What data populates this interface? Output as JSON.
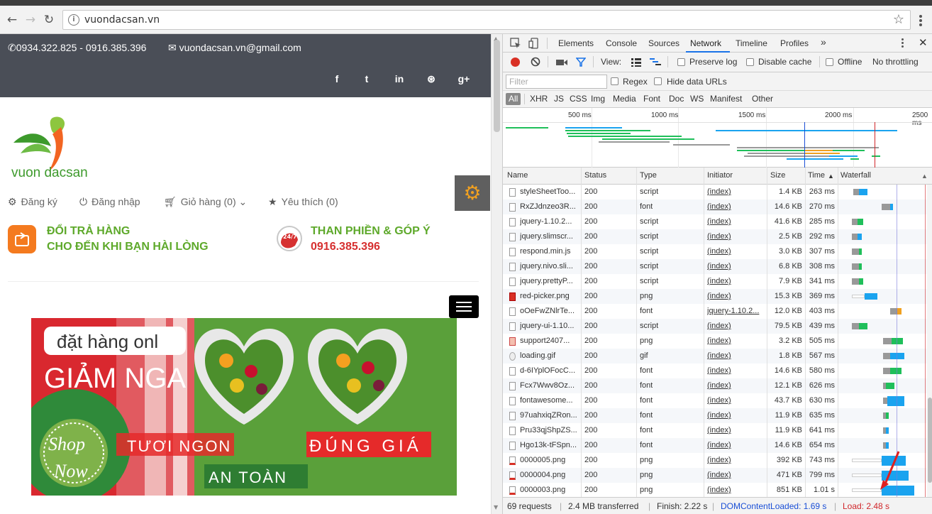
{
  "browser": {
    "url": "vuondacsan.vn"
  },
  "site": {
    "phone": "0934.322.825 - 0916.385.396",
    "email": "vuondacsan.vn@gmail.com",
    "social": [
      "f",
      "t",
      "in",
      "⊛",
      "g+"
    ],
    "logo_text": "vuon dacsan",
    "nav": [
      "Đăng ký",
      "Đăng nhập",
      "Giỏ hàng (0)",
      "Yêu thích (0)"
    ],
    "promo1": {
      "line1": "ĐỔI TRẢ HÀNG",
      "line2": "CHO ĐẾN KHI BẠN HÀI LÒNG"
    },
    "promo2": {
      "line1": "THAN PHIỀN & GÓP Ý",
      "line2": "0916.385.396",
      "badge": "24/7"
    },
    "banner": {
      "search_text": "đặt hàng onl",
      "headline": "GIẢM NGA",
      "shop_now_1": "Shop",
      "shop_now_2": "Now",
      "tag_fresh": "TƯƠI NGON",
      "tag_price": "ĐÚNG GIÁ",
      "tag_safe": "AN TOÀN"
    }
  },
  "devtools": {
    "tabs": [
      "Elements",
      "Console",
      "Sources",
      "Network",
      "Timeline",
      "Profiles"
    ],
    "active_tab": "Network",
    "toolbar": {
      "view_label": "View:",
      "preserve_log": "Preserve log",
      "disable_cache": "Disable cache",
      "offline": "Offline",
      "throttling": "No throttling"
    },
    "filter_placeholder": "Filter",
    "regex": "Regex",
    "hide_data_urls": "Hide data URLs",
    "filter_types": [
      "All",
      "XHR",
      "JS",
      "CSS",
      "Img",
      "Media",
      "Font",
      "Doc",
      "WS",
      "Manifest",
      "Other"
    ],
    "overview_ticks": [
      "500 ms",
      "1000 ms",
      "1500 ms",
      "2000 ms",
      "2500 ms"
    ],
    "columns": [
      "Name",
      "Status",
      "Type",
      "Initiator",
      "Size",
      "Time",
      "Waterfall"
    ],
    "requests": [
      {
        "name": "styleSheetToo...",
        "status": "200",
        "type": "script",
        "initiator": "(index)",
        "size": "1.4 KB",
        "time": "263 ms",
        "icon": "doc"
      },
      {
        "name": "RxZJdnzeo3R...",
        "status": "200",
        "type": "font",
        "initiator": "(index)",
        "size": "14.6 KB",
        "time": "270 ms",
        "icon": "doc"
      },
      {
        "name": "jquery-1.10.2...",
        "status": "200",
        "type": "script",
        "initiator": "(index)",
        "size": "41.6 KB",
        "time": "285 ms",
        "icon": "doc"
      },
      {
        "name": "jquery.slimscr...",
        "status": "200",
        "type": "script",
        "initiator": "(index)",
        "size": "2.5 KB",
        "time": "292 ms",
        "icon": "doc"
      },
      {
        "name": "respond.min.js",
        "status": "200",
        "type": "script",
        "initiator": "(index)",
        "size": "3.0 KB",
        "time": "307 ms",
        "icon": "doc"
      },
      {
        "name": "jquery.nivo.sli...",
        "status": "200",
        "type": "script",
        "initiator": "(index)",
        "size": "6.8 KB",
        "time": "308 ms",
        "icon": "doc"
      },
      {
        "name": "jquery.prettyP...",
        "status": "200",
        "type": "script",
        "initiator": "(index)",
        "size": "7.9 KB",
        "time": "341 ms",
        "icon": "doc"
      },
      {
        "name": "red-picker.png",
        "status": "200",
        "type": "png",
        "initiator": "(index)",
        "size": "15.3 KB",
        "time": "369 ms",
        "icon": "red"
      },
      {
        "name": "oOeFwZNlrTe...",
        "status": "200",
        "type": "font",
        "initiator": "jquery-1.10.2...",
        "size": "12.0 KB",
        "time": "403 ms",
        "icon": "doc"
      },
      {
        "name": "jquery-ui-1.10...",
        "status": "200",
        "type": "script",
        "initiator": "(index)",
        "size": "79.5 KB",
        "time": "439 ms",
        "icon": "doc"
      },
      {
        "name": "support2407...",
        "status": "200",
        "type": "png",
        "initiator": "(index)",
        "size": "3.2 KB",
        "time": "505 ms",
        "icon": "support"
      },
      {
        "name": "loading.gif",
        "status": "200",
        "type": "gif",
        "initiator": "(index)",
        "size": "1.8 KB",
        "time": "567 ms",
        "icon": "gif"
      },
      {
        "name": "d-6IYplOFocC...",
        "status": "200",
        "type": "font",
        "initiator": "(index)",
        "size": "14.6 KB",
        "time": "580 ms",
        "icon": "doc"
      },
      {
        "name": "Fcx7Wwv8Oz...",
        "status": "200",
        "type": "font",
        "initiator": "(index)",
        "size": "12.1 KB",
        "time": "626 ms",
        "icon": "doc"
      },
      {
        "name": "fontawesome...",
        "status": "200",
        "type": "font",
        "initiator": "(index)",
        "size": "43.7 KB",
        "time": "630 ms",
        "icon": "doc"
      },
      {
        "name": "97uahxiqZRon...",
        "status": "200",
        "type": "font",
        "initiator": "(index)",
        "size": "11.9 KB",
        "time": "635 ms",
        "icon": "doc"
      },
      {
        "name": "Pru33qjShpZS...",
        "status": "200",
        "type": "font",
        "initiator": "(index)",
        "size": "11.9 KB",
        "time": "641 ms",
        "icon": "doc"
      },
      {
        "name": "Hgo13k-tFSpn...",
        "status": "200",
        "type": "font",
        "initiator": "(index)",
        "size": "14.6 KB",
        "time": "654 ms",
        "icon": "doc"
      },
      {
        "name": "0000005.png",
        "status": "200",
        "type": "png",
        "initiator": "(index)",
        "size": "392 KB",
        "time": "743 ms",
        "icon": "img"
      },
      {
        "name": "0000004.png",
        "status": "200",
        "type": "png",
        "initiator": "(index)",
        "size": "471 KB",
        "time": "799 ms",
        "icon": "img"
      },
      {
        "name": "0000003.png",
        "status": "200",
        "type": "png",
        "initiator": "(index)",
        "size": "851 KB",
        "time": "1.01 s",
        "icon": "img"
      }
    ],
    "summary": {
      "requests": "69 requests",
      "transferred": "2.4 MB transferred",
      "finish": "Finish: 2.22 s",
      "dom_loaded": "DOMContentLoaded: 1.69 s",
      "load": "Load: 2.48 s"
    },
    "colors": {
      "dom_loaded": "#1a4fd6",
      "load": "#d0262a",
      "bar_green": "#1fbf5a",
      "bar_blue": "#1aa3ef",
      "bar_orange": "#f0a020"
    }
  }
}
